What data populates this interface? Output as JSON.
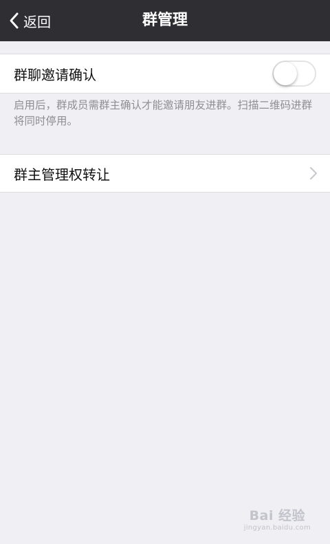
{
  "nav": {
    "back_label": "返回",
    "title": "群管理"
  },
  "invite_confirm": {
    "label": "群聊邀请确认",
    "enabled": false,
    "description": "启用后，群成员需群主确认才能邀请朋友进群。扫描二维码进群将同时停用。"
  },
  "owner_transfer": {
    "label": "群主管理权转让"
  },
  "watermark": {
    "text": "Bai 经验",
    "url": "jingyan.baidu.com"
  },
  "colors": {
    "nav_background": "#2e2e33",
    "page_background": "#efeff4",
    "cell_background": "#ffffff",
    "secondary_text": "#8e8e93"
  },
  "icons": {
    "back": "chevron-left-icon",
    "disclosure": "chevron-right-icon"
  }
}
